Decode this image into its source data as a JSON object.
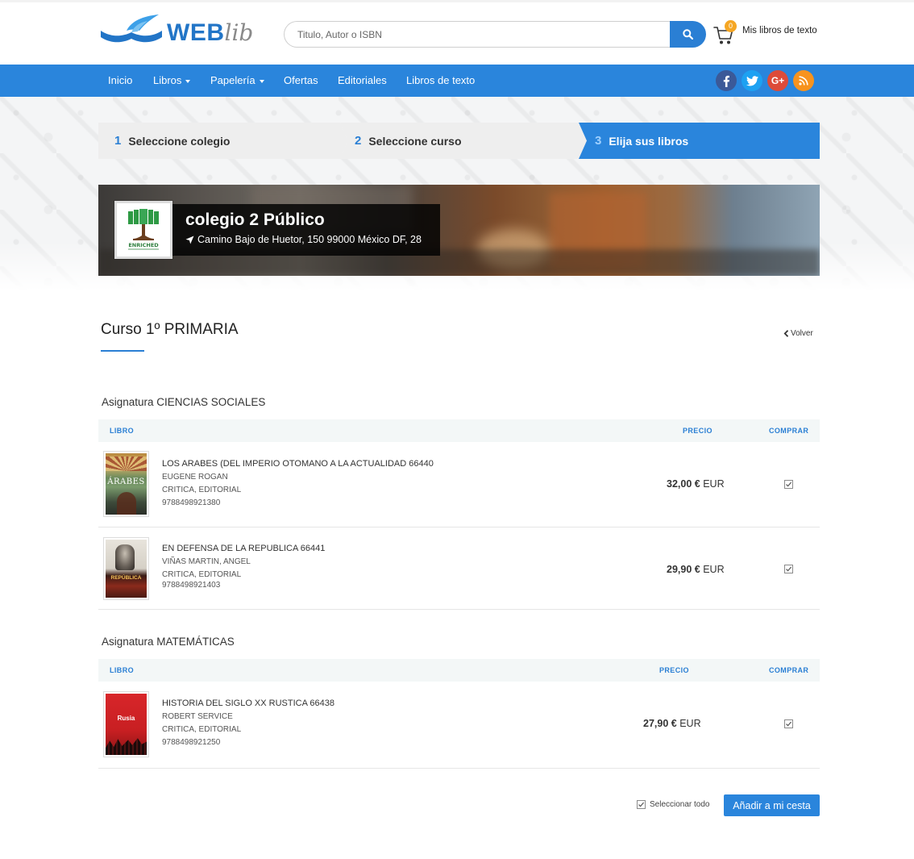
{
  "header": {
    "logo_web": "WEB",
    "logo_lib": "lib",
    "search_placeholder": "Titulo, Autor o ISBN",
    "cart_count": "0",
    "cart_label": "Mis libros de texto"
  },
  "nav": {
    "items": [
      "Inicio",
      "Libros",
      "Papelería",
      "Ofertas",
      "Editoriales",
      "Libros de texto"
    ],
    "social": [
      "facebook",
      "twitter",
      "google-plus",
      "rss"
    ]
  },
  "steps": [
    {
      "num": "1",
      "label": "Seleccione colegio"
    },
    {
      "num": "2",
      "label": "Seleccione curso"
    },
    {
      "num": "3",
      "label": "Elija sus libros"
    }
  ],
  "school": {
    "name": "colegio 2 Público",
    "address": "Camino Bajo de Huetor, 150 99000 México DF, 28",
    "logo_text": "ENRICHED"
  },
  "course": {
    "title": "Curso 1º PRIMARIA",
    "back_label": "Volver"
  },
  "subjects": [
    {
      "title": "Asignatura CIENCIAS SOCIALES",
      "headers": {
        "book": "LIBRO",
        "price": "PRECIO",
        "buy": "COMPRAR"
      },
      "books": [
        {
          "title": "LOS ARABES (DEL IMPERIO OTOMANO A LA ACTUALIDAD 66440",
          "author": "EUGENE ROGAN",
          "publisher": "CRITICA, EDITORIAL",
          "isbn": "9788498921380",
          "price": "32,00 €",
          "currency": "EUR",
          "cover_text": "ÁRABES"
        },
        {
          "title": "EN DEFENSA DE LA REPUBLICA 66441",
          "author": "VIÑAS MARTIN, ANGEL",
          "publisher": "CRITICA, EDITORIAL",
          "isbn": "9788498921403",
          "price": "29,90 €",
          "currency": "EUR",
          "cover_text": "REPÚBLICA"
        }
      ]
    },
    {
      "title": "Asignatura MATEMÁTICAS",
      "headers": {
        "book": "LIBRO",
        "price": "PRECIO",
        "buy": "COMPRAR"
      },
      "books": [
        {
          "title": "HISTORIA DEL SIGLO XX RUSTICA 66438",
          "author": "ROBERT SERVICE",
          "publisher": "CRITICA, EDITORIAL",
          "isbn": "9788498921250",
          "price": "27,90 €",
          "currency": "EUR",
          "cover_text": "Rusia"
        }
      ]
    }
  ],
  "footer_actions": {
    "select_all": "Seleccionar todo",
    "add_to_cart": "Añadir a mi cesta"
  },
  "colors": {
    "primary": "#2a85dc",
    "accent": "#2a7fd4",
    "badge": "#f5a623",
    "facebook": "#3b5998",
    "twitter": "#1da1f2",
    "google_plus": "#dd4b39",
    "rss": "#f7931e"
  }
}
